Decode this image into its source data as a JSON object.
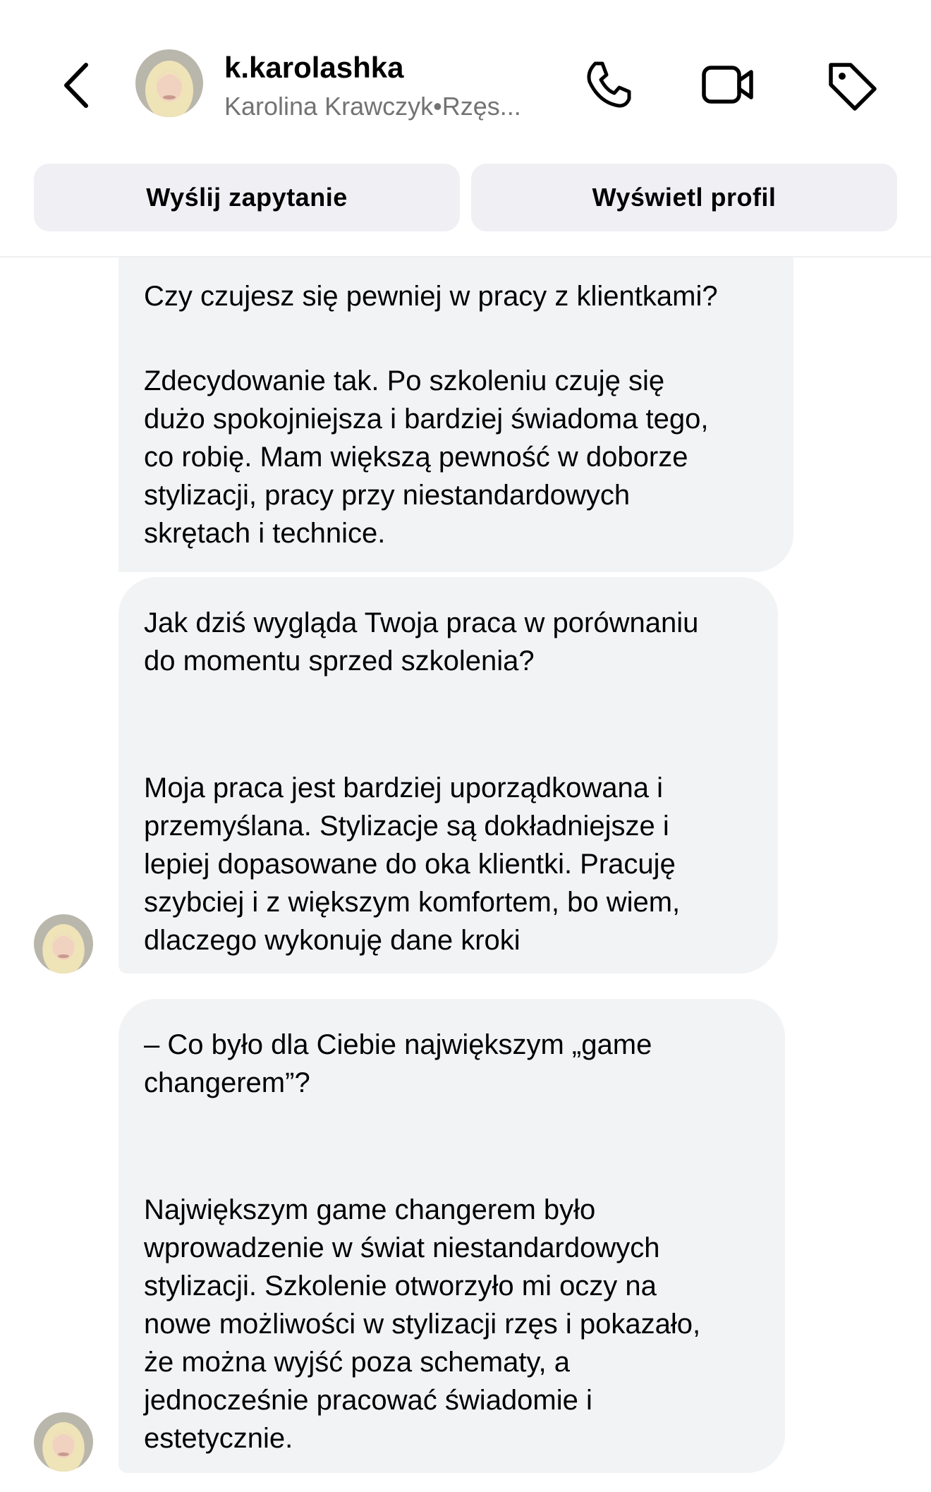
{
  "header": {
    "username": "k.karolashka",
    "subtitle": "Karolina Krawczyk•Rzęs...",
    "actions": [
      "phone-icon",
      "video-icon",
      "tag-icon"
    ],
    "buttons": {
      "send_request": "Wyślij zapytanie",
      "view_profile": "Wyświetl profil"
    }
  },
  "messages": [
    {
      "question": "Czy czujesz się pewniej w pracy z klientkami?",
      "answer": "Zdecydowanie tak. Po szkoleniu czuję się\ndużo spokojniejsza i bardziej świadoma tego,\nco robię. Mam większą pewność w doborze\nstylizacji, pracy przy niestandardowych\nskrętach i technice."
    },
    {
      "question": "Jak dziś wygląda Twoja praca w porównaniu\ndo momentu sprzed szkolenia?",
      "answer": "Moja praca jest bardziej uporządkowana i\nprzemyślana. Stylizacje są dokładniejsze i\nlepiej dopasowane do oka klientki. Pracuję\nszybciej i z większym komfortem, bo wiem,\ndlaczego wykonuję dane kroki"
    },
    {
      "question": "– Co było dla Ciebie największym „game\nchangerem”?",
      "answer": "Największym game changerem było\nwprowadzenie w świat niestandardowych\nstylizacji. Szkolenie otworzyło mi oczy na\nnowe możliwości w stylizacji rzęs i pokazało,\nże można wyjść poza schematy, a\njednocześnie pracować świadomie i\nestetycznie."
    }
  ],
  "colors": {
    "bubble_bg": "#f2f3f5",
    "button_bg": "#efeff4",
    "subtitle_text": "#737373"
  }
}
